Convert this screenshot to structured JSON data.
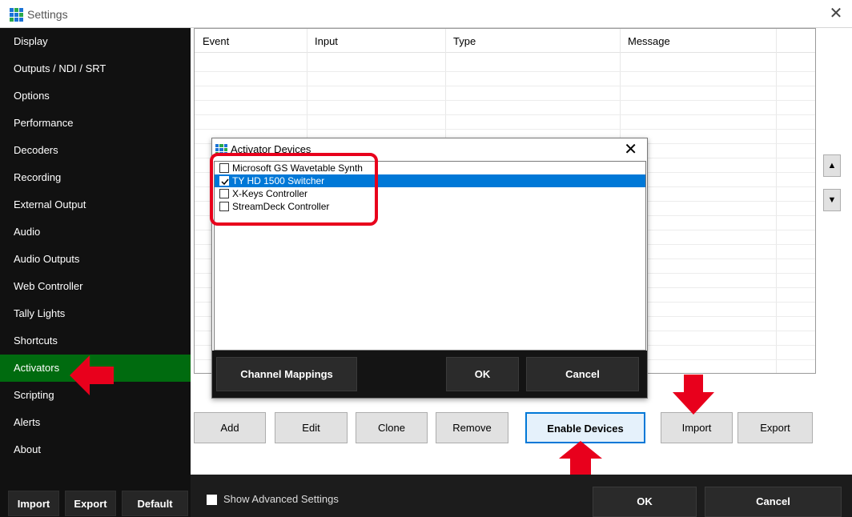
{
  "window": {
    "title": "Settings"
  },
  "sidebar": {
    "items": [
      {
        "label": "Display"
      },
      {
        "label": "Outputs / NDI / SRT"
      },
      {
        "label": "Options"
      },
      {
        "label": "Performance"
      },
      {
        "label": "Decoders"
      },
      {
        "label": "Recording"
      },
      {
        "label": "External Output"
      },
      {
        "label": "Audio"
      },
      {
        "label": "Audio Outputs"
      },
      {
        "label": "Web Controller"
      },
      {
        "label": "Tally Lights"
      },
      {
        "label": "Shortcuts"
      },
      {
        "label": "Activators",
        "active": true
      },
      {
        "label": "Scripting"
      },
      {
        "label": "Alerts"
      },
      {
        "label": "About"
      }
    ],
    "buttons": {
      "import": "Import",
      "export": "Export",
      "default": "Default"
    },
    "active_color": "#006b0f"
  },
  "table": {
    "columns": [
      "Event",
      "Input",
      "Type",
      "Message"
    ]
  },
  "actions": {
    "add": "Add",
    "edit": "Edit",
    "clone": "Clone",
    "remove": "Remove",
    "enable_devices": "Enable Devices",
    "import": "Import",
    "export": "Export",
    "move_up": "▲",
    "move_down": "▼"
  },
  "footer": {
    "advanced_label": "Show Advanced Settings",
    "ok": "OK",
    "cancel": "Cancel"
  },
  "dialog": {
    "title": "Activator Devices",
    "close": "✕",
    "devices": [
      {
        "label": "Microsoft GS Wavetable Synth",
        "checked": false,
        "selected": false
      },
      {
        "label": "TY HD 1500 Switcher",
        "checked": true,
        "selected": true
      },
      {
        "label": "X-Keys Controller",
        "checked": false,
        "selected": false
      },
      {
        "label": "StreamDeck Controller",
        "checked": false,
        "selected": false
      }
    ],
    "buttons": {
      "channel_mappings": "Channel Mappings",
      "ok": "OK",
      "cancel": "Cancel"
    }
  },
  "annotations": {
    "color": "#e8001c"
  }
}
